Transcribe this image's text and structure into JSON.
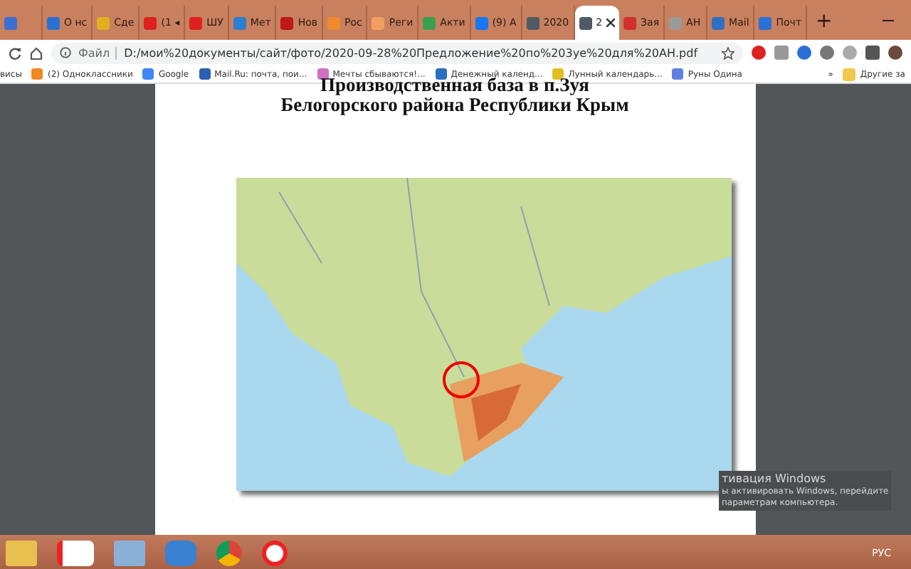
{
  "tabs": [
    {
      "color": "#3b6fd1",
      "selected": false
    },
    {
      "label": "О нс",
      "color": "#2a6fd6",
      "selected": false
    },
    {
      "label": "Сде",
      "color": "#e0b020",
      "selected": false
    },
    {
      "label": "(1 ◂",
      "color": "#e02020",
      "selected": false
    },
    {
      "label": "ШУ",
      "color": "#e02020",
      "selected": false
    },
    {
      "label": "Мет",
      "color": "#2a7fd0",
      "selected": false
    },
    {
      "label": "Нов",
      "color": "#c01818",
      "selected": false
    },
    {
      "label": "Рос",
      "color": "#f08a30",
      "selected": false
    },
    {
      "label": "Реги",
      "color": "#f0a060",
      "selected": false
    },
    {
      "label": "Акти",
      "color": "#3aa050",
      "selected": false
    },
    {
      "label": "(9) А",
      "color": "#1877f2",
      "selected": false
    },
    {
      "label": "2020",
      "color": "#505a64",
      "selected": false
    },
    {
      "label": "2",
      "color": "#505a64",
      "selected": true
    },
    {
      "label": "Зая",
      "color": "#d03030",
      "selected": false
    },
    {
      "label": "АН",
      "color": "#9a9a9a",
      "selected": false
    },
    {
      "label": "Mail",
      "color": "#3070c0",
      "selected": false
    },
    {
      "label": "Почт",
      "color": "#2a70d8",
      "selected": false
    }
  ],
  "new_tab": "+",
  "address": {
    "scheme": "Файл",
    "url": "D:/мои%20документы/сайт/фото/2020-09-28%20Предложение%20по%203уе%20для%20АН.pdf"
  },
  "bookmarks": [
    {
      "label": "висы"
    },
    {
      "label": "(2) Одноклассники",
      "color": "#f08a20"
    },
    {
      "label": "Google",
      "color": "#4285f4"
    },
    {
      "label": "Mail.Ru: почта, пои...",
      "color": "#2c5fb0"
    },
    {
      "label": "Мечты сбываются!...",
      "color": "#d070c0"
    },
    {
      "label": "Денежный календ...",
      "color": "#2a6fc0"
    },
    {
      "label": "Лунный календарь...",
      "color": "#e0c020"
    },
    {
      "label": "Руны Одина",
      "color": "#6080e0"
    }
  ],
  "bookmarks_more": "»",
  "other_bookmarks": "Другие за",
  "document": {
    "title_lines": [
      "Производственная база в п.Зуя",
      "Белогорского района Республики Крым"
    ]
  },
  "activation": [
    "тивация Windows",
    "ы активировать Windows, перейдите",
    "параметрам компьютера."
  ],
  "taskbar": {
    "language": "РУС"
  }
}
